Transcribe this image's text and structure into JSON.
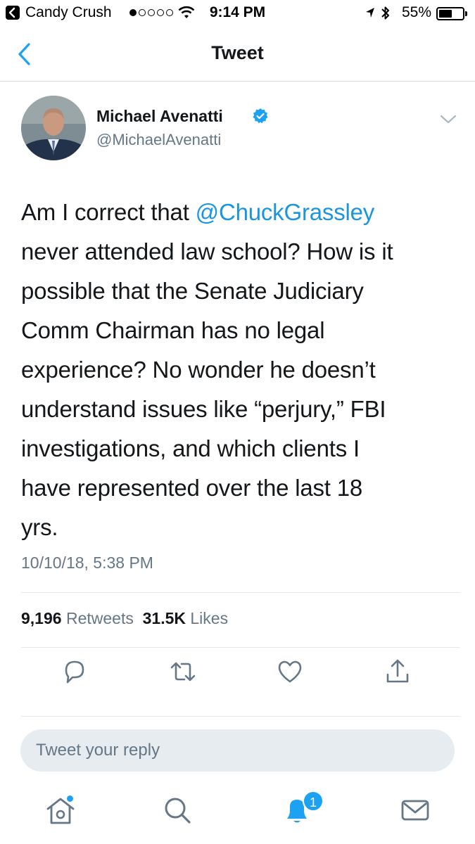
{
  "status_bar": {
    "back_app": "Candy Crush",
    "time": "9:14 PM",
    "battery": "55%",
    "battery_level": 0.55
  },
  "nav": {
    "title": "Tweet",
    "back_icon": "chevron-left-icon"
  },
  "tweet": {
    "display_name": "Michael Avenatti",
    "verified": true,
    "handle": "@MichaelAvenatti",
    "lines": [
      {
        "pre": "Am I correct that ",
        "mention": "@ChuckGrassley",
        "post": ""
      },
      {
        "pre": "never attended law school? How is it",
        "mention": "",
        "post": ""
      },
      {
        "pre": "possible that the Senate Judiciary",
        "mention": "",
        "post": ""
      },
      {
        "pre": "Comm Chairman has no legal",
        "mention": "",
        "post": ""
      },
      {
        "pre": "experience? No wonder he doesn’t",
        "mention": "",
        "post": ""
      },
      {
        "pre": "understand issues like “perjury,” FBI",
        "mention": "",
        "post": ""
      },
      {
        "pre": "investigations, and which clients I",
        "mention": "",
        "post": ""
      },
      {
        "pre": "have represented over the last 18",
        "mention": "",
        "post": ""
      },
      {
        "pre": "yrs.",
        "mention": "",
        "post": ""
      }
    ],
    "timestamp": "10/10/18, 5:38 PM",
    "retweets_count": "9,196",
    "retweets_label": "Retweets",
    "likes_count": "31.5K",
    "likes_label": "Likes"
  },
  "actions": {
    "icons": [
      "reply-icon",
      "retweet-icon",
      "like-icon",
      "share-icon"
    ]
  },
  "reply": {
    "placeholder": "Tweet your reply"
  },
  "tabbar": {
    "icons": [
      "home-icon",
      "search-icon",
      "notifications-icon",
      "messages-icon"
    ],
    "notification_count": "1"
  },
  "colors": {
    "accent": "#1da1f2",
    "link": "#1b95e0",
    "secondary_text": "#657786",
    "reply_box_bg": "#e6ecf0"
  }
}
